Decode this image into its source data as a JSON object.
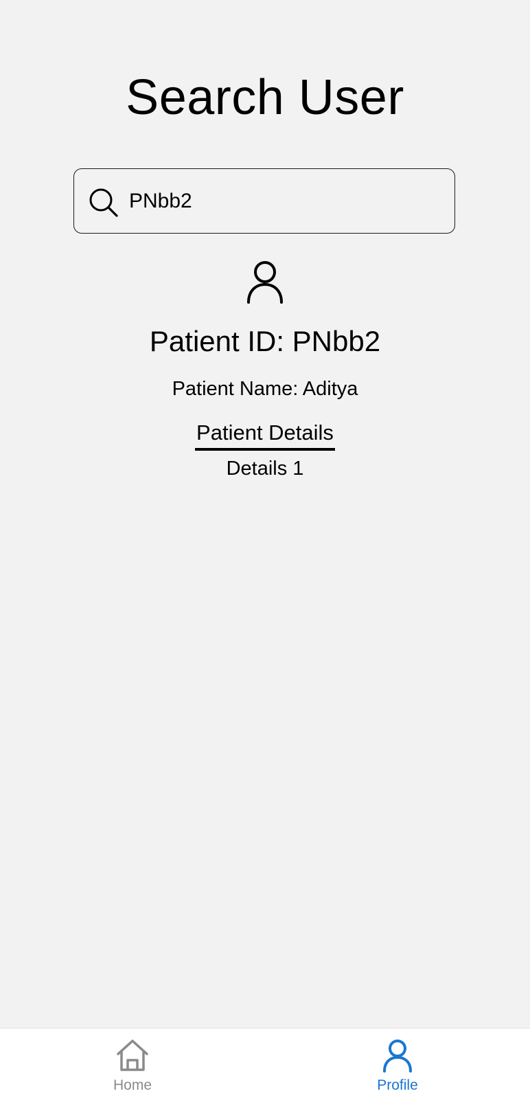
{
  "header": {
    "title": "Search User"
  },
  "search": {
    "value": "PNbb2",
    "icon": "search-icon"
  },
  "patient": {
    "avatar_icon": "user-icon",
    "id_text": "Patient ID: PNbb2",
    "name_text": "Patient Name: Aditya",
    "details_tab_label": "Patient Details",
    "details_content": "Details 1"
  },
  "bottom_nav": {
    "items": [
      {
        "label": "Home",
        "icon": "home-icon",
        "active": false
      },
      {
        "label": "Profile",
        "icon": "user-icon",
        "active": true
      }
    ],
    "active_color": "#1976d2",
    "inactive_color": "#8a8a8a"
  },
  "colors": {
    "background": "#f2f2f2",
    "nav_background": "#ffffff"
  }
}
